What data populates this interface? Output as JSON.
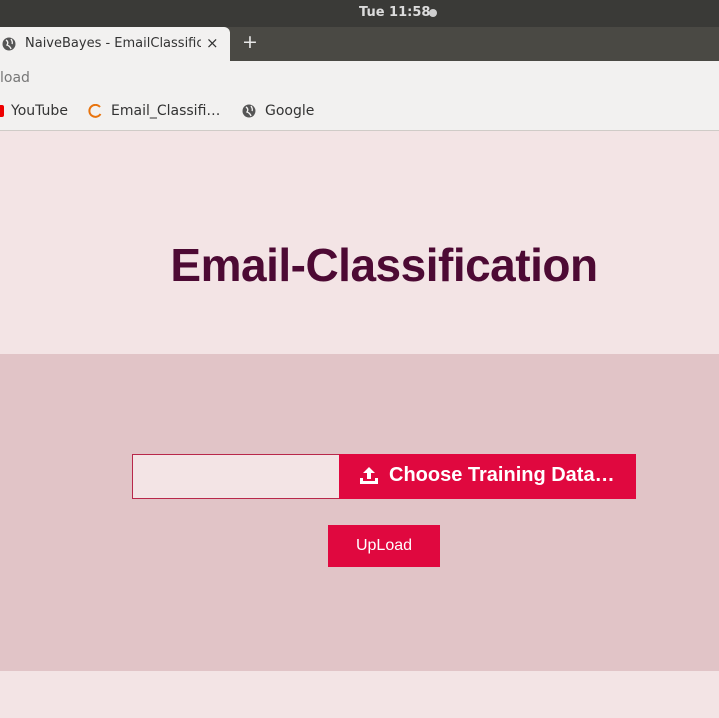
{
  "os": {
    "clock": "Tue 11:58"
  },
  "browser": {
    "tab_title": "NaiveBayes - EmailClassification",
    "tab_close": "×",
    "new_tab": "+",
    "url_visible": "load",
    "bookmarks": [
      {
        "label": "YouTube",
        "icon": "youtube-icon"
      },
      {
        "label": "Email_Classifi…",
        "icon": "loading-spinner-icon"
      },
      {
        "label": "Google",
        "icon": "globe-icon"
      }
    ]
  },
  "page": {
    "title": "Email-Classification",
    "choose_label": "Choose Training Data…",
    "upload_label": "UpLoad",
    "colors": {
      "accent": "#e0083f",
      "title": "#4d0a34",
      "background": "#f3e4e5",
      "form_section": "#e1c4c7"
    }
  }
}
